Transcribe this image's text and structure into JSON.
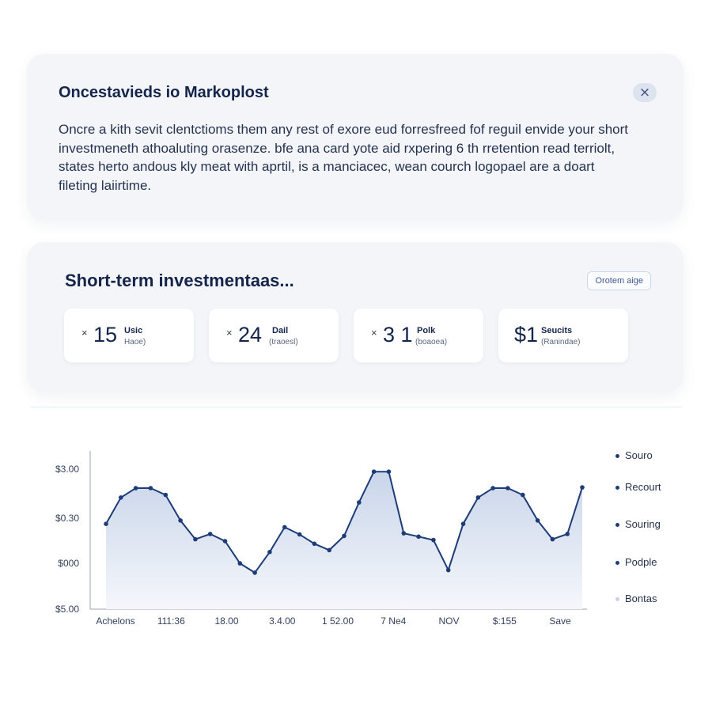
{
  "intro": {
    "title": "Oncestavieds io Markoplost",
    "close_label": "×",
    "body": "Oncre a kith sevit clentctioms them any rest of exore eud forresfreed fof reguil envide your short investmeneth athoaluting orasenze. bfe ana card yote aid rxpering 6 th rretention read terriolt, states herto andous kly meat with aprtil, is a manciacec, wean courch logopael are a doart fileting laiirtime."
  },
  "investments": {
    "title": "Short-term investmentaas...",
    "action_label": "Orotem aige",
    "stats": [
      {
        "mark": "×",
        "value": "15",
        "label": "Usic",
        "sub": "Haoe)"
      },
      {
        "mark": "×",
        "value": "24",
        "label": "Dail",
        "sub": "(traoesl)"
      },
      {
        "mark": "×",
        "value": "3 1",
        "label": "Polk",
        "sub": "(boaoea)"
      },
      {
        "mark": "",
        "value": "$1",
        "label": "Seucits",
        "sub": "(Ranindae)"
      }
    ]
  },
  "chart_data": {
    "type": "area",
    "y_tick_labels": [
      "$3.00",
      "$0.30",
      "$000",
      "$5.00"
    ],
    "x_tick_labels": [
      "Achelons",
      "111:36",
      "18.00",
      "3.4.00",
      "1 52.00",
      "7 Ne4",
      "NOV",
      "$:155",
      "Save"
    ],
    "x": [
      0,
      0.25,
      0.5,
      0.75,
      1,
      1.25,
      1.5,
      1.75,
      2,
      2.25,
      2.5,
      2.75,
      3,
      3.25,
      3.5,
      3.75,
      4,
      4.25,
      4.5,
      4.75,
      5,
      5.25,
      5.5,
      5.75,
      6,
      6.25,
      6.5,
      6.75,
      7,
      7.25,
      7.5,
      7.75,
      8
    ],
    "y": [
      2.27,
      2.97,
      3.22,
      3.22,
      3.04,
      2.36,
      1.86,
      2.0,
      1.81,
      1.22,
      0.97,
      1.52,
      2.18,
      1.99,
      1.74,
      1.57,
      1.95,
      2.84,
      3.66,
      3.66,
      2.02,
      1.93,
      1.84,
      1.04,
      2.27,
      2.97,
      3.22,
      3.22,
      3.04,
      2.36,
      1.86,
      2.0,
      3.24
    ],
    "ylim": [
      0,
      4
    ],
    "legend": [
      "Souro",
      "Recourt",
      "Souring",
      "Podple",
      "Bontas"
    ],
    "colors": {
      "line": "#1d3c78",
      "fill_top": "#c9d5ea",
      "fill_bottom": "#f5f7fb",
      "axis": "#9aa3b5"
    }
  }
}
